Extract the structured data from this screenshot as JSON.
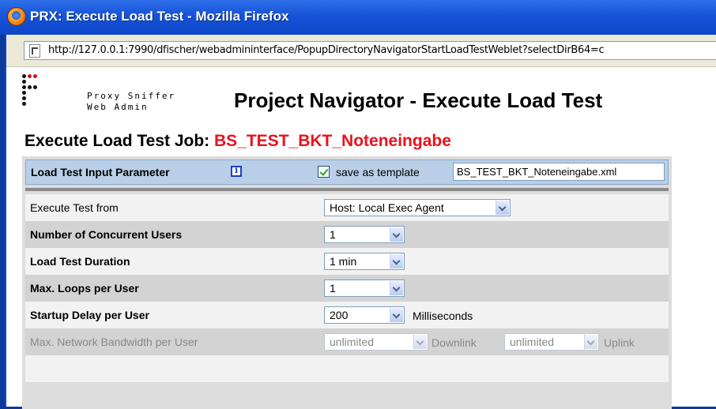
{
  "window": {
    "title": "PRX: Execute Load Test - Mozilla Firefox"
  },
  "browser": {
    "url": "http://127.0.0.1:7990/dfischer/webadmininterface/PopupDirectoryNavigatorStartLoadTestWeblet?selectDirB64=c"
  },
  "brand": {
    "line1": "Proxy Sniffer",
    "line2": "Web Admin"
  },
  "page": {
    "heading": "Project Navigator - Execute Load Test",
    "job_prefix": "Execute Load Test Job: ",
    "job_name": "BS_TEST_BKT_Noteneingabe"
  },
  "panel": {
    "header_label": "Load Test Input Parameter",
    "save_template_checked": true,
    "save_template_label": "save as template",
    "template_filename": "BS_TEST_BKT_Noteneingabe.xml"
  },
  "params": {
    "execute_from": {
      "label": "Execute Test from",
      "value": "Host:  Local Exec Agent"
    },
    "users": {
      "label": "Number of Concurrent Users",
      "value": "1"
    },
    "duration": {
      "label": "Load Test Duration",
      "value": "1 min"
    },
    "loops": {
      "label": "Max. Loops per User",
      "value": "1"
    },
    "startup_delay": {
      "label": "Startup Delay per User",
      "value": "200",
      "unit": "Milliseconds"
    },
    "bandwidth": {
      "label": "Max. Network Bandwidth per User",
      "downlink_value": "unlimited",
      "downlink_label": "Downlink",
      "uplink_value": "unlimited",
      "uplink_label": "Uplink"
    }
  },
  "colors": {
    "title_bar": "#1653d8",
    "job_name": "#e8121c",
    "panel_header": "#b9cfe8",
    "row_light": "#f2f2f2",
    "row_dark": "#d3d3d3"
  }
}
